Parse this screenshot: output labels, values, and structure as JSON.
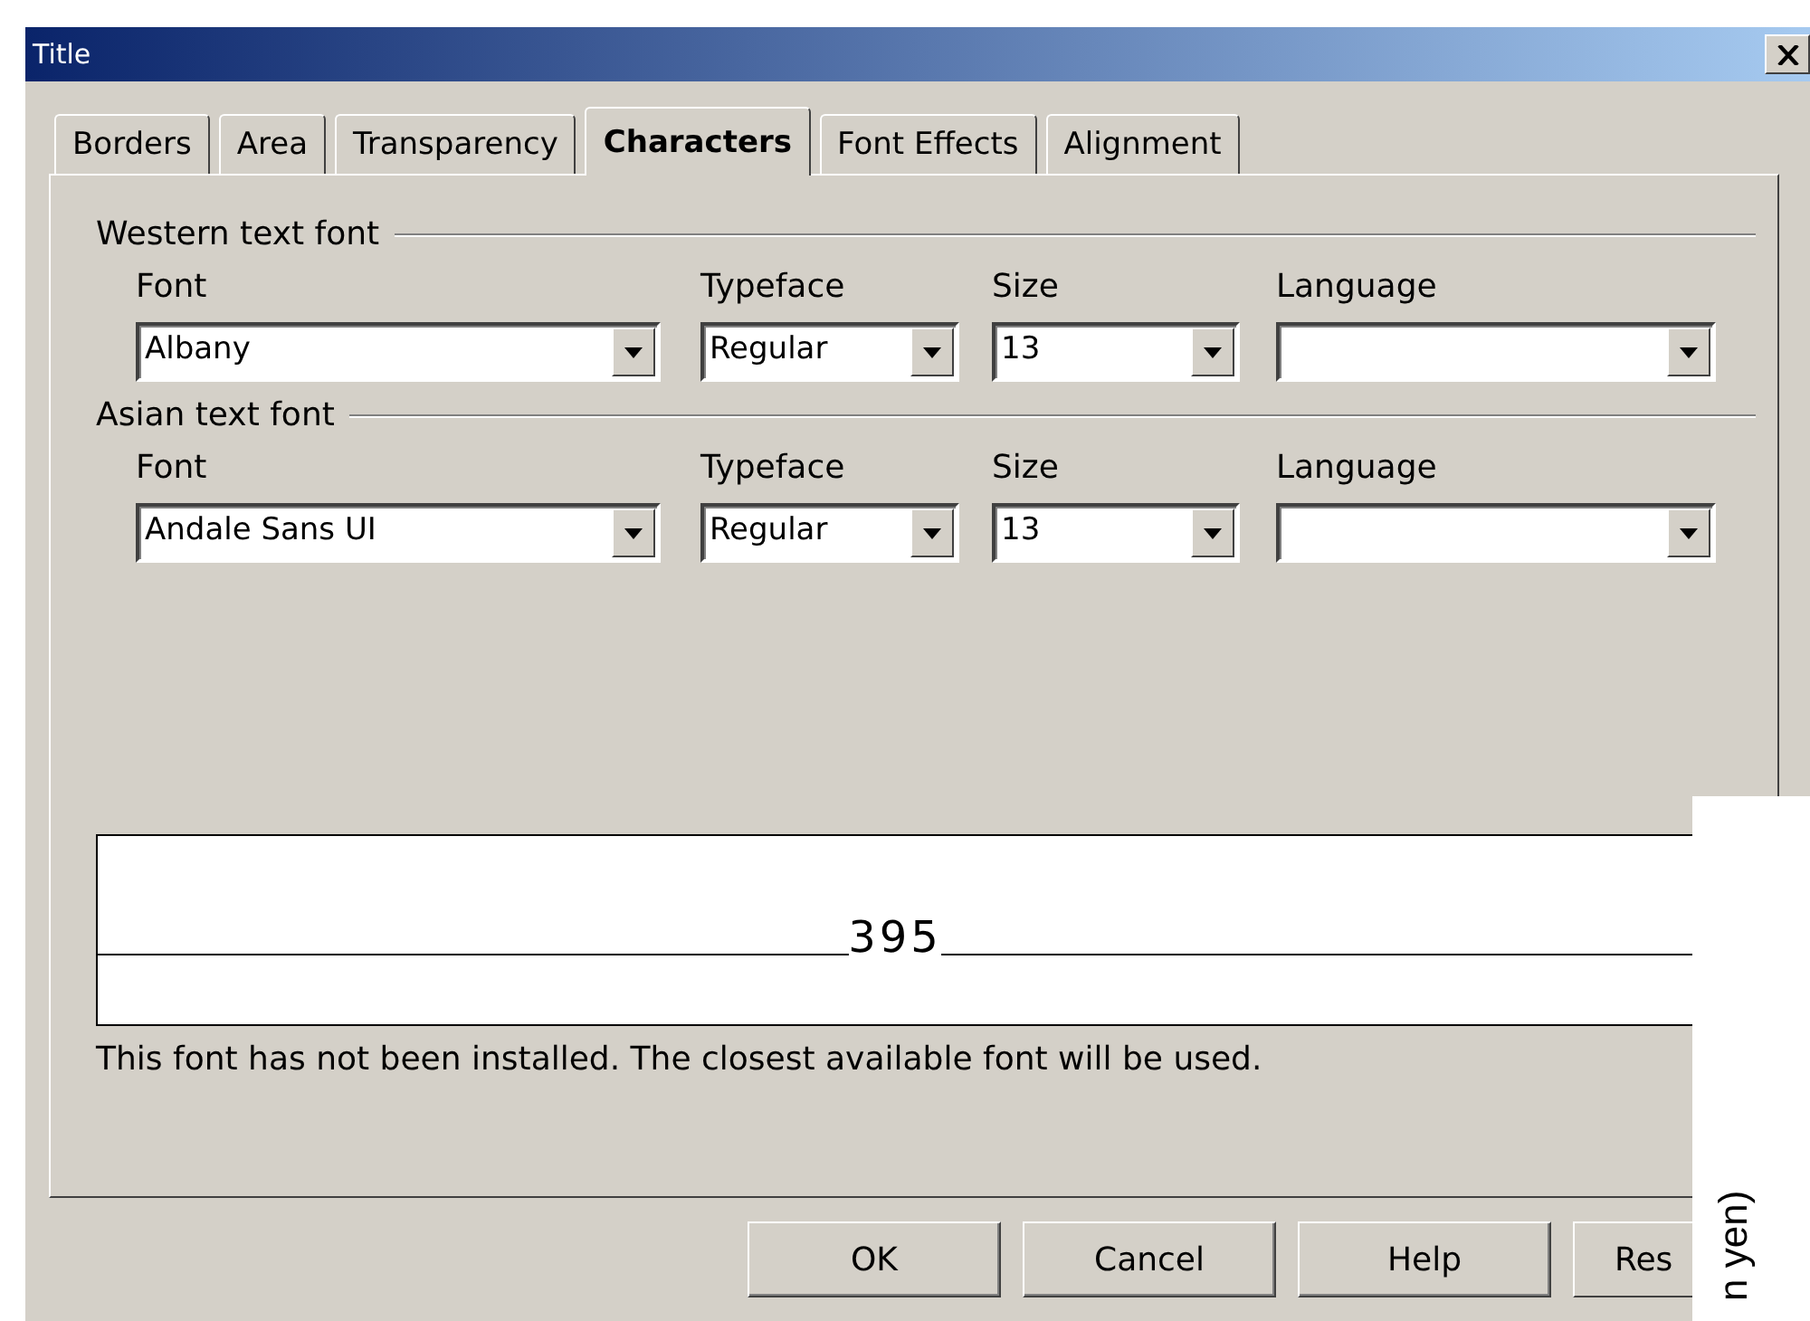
{
  "window": {
    "title": "Title"
  },
  "tabs": [
    {
      "label": "Borders",
      "selected": false
    },
    {
      "label": "Area",
      "selected": false
    },
    {
      "label": "Transparency",
      "selected": false
    },
    {
      "label": "Characters",
      "selected": true
    },
    {
      "label": "Font Effects",
      "selected": false
    },
    {
      "label": "Alignment",
      "selected": false
    }
  ],
  "groups": [
    {
      "title": "Western text font",
      "fields": [
        {
          "label": "Font",
          "value": "Albany"
        },
        {
          "label": "Typeface",
          "value": "Regular"
        },
        {
          "label": "Size",
          "value": "13"
        },
        {
          "label": "Language"
        }
      ]
    },
    {
      "title": "Asian text font",
      "fields": [
        {
          "label": "Font",
          "value": "Andale Sans UI"
        },
        {
          "label": "Typeface",
          "value": "Regular"
        },
        {
          "label": "Size",
          "value": "13"
        },
        {
          "label": "Language"
        }
      ]
    }
  ],
  "preview": {
    "sample": "395"
  },
  "note": "This font has not been installed. The closest available font will be used.",
  "buttons": [
    "OK",
    "Cancel",
    "Help",
    "Res"
  ],
  "overlay": {
    "text": "n yen)"
  }
}
